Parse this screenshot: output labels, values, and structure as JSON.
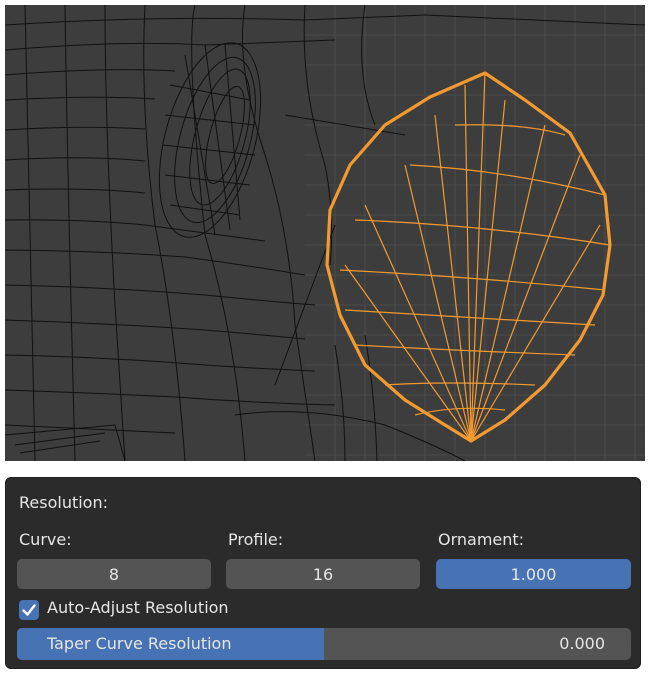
{
  "viewport": {
    "background": "#3d3d3d",
    "wire_color": "#101010",
    "selected_color": "#f29a30"
  },
  "panel": {
    "section_label": "Resolution:",
    "curve": {
      "label": "Curve:",
      "value": "8"
    },
    "profile": {
      "label": "Profile:",
      "value": "16"
    },
    "ornament": {
      "label": "Ornament:",
      "value": "1.000"
    },
    "auto_adjust": {
      "label": "Auto-Adjust Resolution",
      "checked": true
    },
    "taper": {
      "label": "Taper Curve Resolution",
      "value": "0.000",
      "fill_fraction": 0.5
    },
    "accent": "#4772b3"
  }
}
